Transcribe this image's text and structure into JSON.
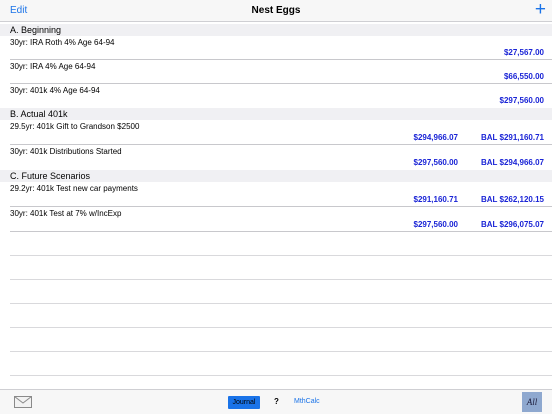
{
  "nav": {
    "edit": "Edit",
    "title": "Nest Eggs",
    "add": "+"
  },
  "sections": [
    {
      "header": "A. Beginning",
      "rows": [
        {
          "title": "30yr: IRA Roth 4% Age 64-94",
          "amount": "",
          "balance": "$27,567.00"
        },
        {
          "title": "30yr: IRA 4% Age 64-94",
          "amount": "",
          "balance": "$66,550.00"
        },
        {
          "title": "30yr: 401k 4% Age 64-94",
          "amount": "",
          "balance": "$297,560.00"
        }
      ]
    },
    {
      "header": "B. Actual 401k",
      "rows": [
        {
          "title": "29.5yr: 401k Gift to Grandson $2500",
          "amount": "$294,966.07",
          "balance": "BAL $291,160.71"
        },
        {
          "title": "30yr: 401k Distributions Started",
          "amount": "$297,560.00",
          "balance": "BAL $294,966.07"
        }
      ]
    },
    {
      "header": "C. Future Scenarios",
      "rows": [
        {
          "title": "29.2yr: 401k Test new car payments",
          "amount": "$291,160.71",
          "balance": "BAL $262,120.15"
        },
        {
          "title": "30yr: 401k Test at 7% w/IncExp",
          "amount": "$297,560.00",
          "balance": "BAL $296,075.07"
        }
      ]
    }
  ],
  "toolbar": {
    "journal": "Journal",
    "help": "?",
    "mthcalc": "MthCalc",
    "all": "All"
  },
  "icons": {
    "mail": "mail-icon",
    "add": "plus-icon"
  },
  "colors": {
    "accent": "#1a73e8",
    "amount": "#1a24d6"
  }
}
